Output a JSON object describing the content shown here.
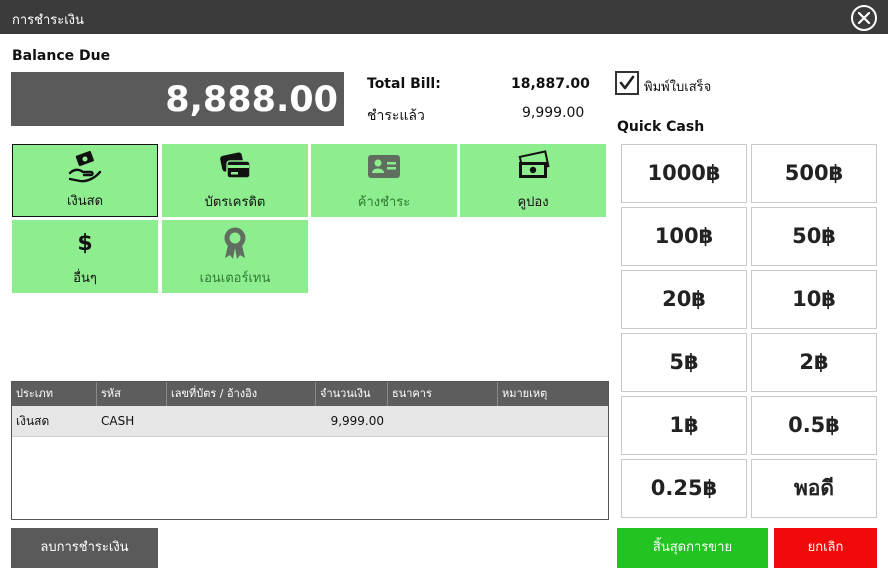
{
  "window": {
    "title": "การชำระเงิน"
  },
  "balance": {
    "label": "Balance Due",
    "amount": "8,888.00"
  },
  "bill": {
    "total_label": "Total Bill:",
    "total_value": "18,887.00",
    "paid_label": "ชำระแล้ว",
    "paid_value": "9,999.00"
  },
  "print_receipt": {
    "label": "พิมพ์ใบเสร็จ",
    "checked": true
  },
  "quick_cash": {
    "label": "Quick Cash",
    "buttons": [
      "1000฿",
      "500฿",
      "100฿",
      "50฿",
      "20฿",
      "10฿",
      "5฿",
      "2฿",
      "1฿",
      "0.5฿",
      "0.25฿",
      "พอดี"
    ]
  },
  "payment_methods": [
    {
      "label": "เงินสด",
      "icon": "cash-hand-icon",
      "selected": true
    },
    {
      "label": "บัตรเครดิต",
      "icon": "credit-card-icon"
    },
    {
      "label": "ค้างชำระ",
      "icon": "contact-card-icon"
    },
    {
      "label": "คูปอง",
      "icon": "money-bill-icon"
    },
    {
      "label": "อื่นๆ",
      "icon": "dollar-sign-icon"
    },
    {
      "label": "เอนเตอร์เทน",
      "icon": "award-icon"
    }
  ],
  "table": {
    "columns": [
      "ประเภท",
      "รหัส",
      "เลขที่บัตร / อ้างอิง",
      "จำนวนเงิน",
      "ธนาคาร",
      "หมายเหตุ"
    ],
    "rows": [
      {
        "type": "เงินสด",
        "code": "CASH",
        "ref": "",
        "amount": "9,999.00",
        "bank": "",
        "note": ""
      }
    ]
  },
  "actions": {
    "clear": "ลบการชำระเงิน",
    "finish": "สิ้นสุดการขาย",
    "cancel": "ยกเลิก"
  },
  "colors": {
    "titlebar": "#3b3b3b",
    "payment_button": "#8eed8e",
    "finish": "#21c421",
    "cancel": "#f00a0a",
    "dark_box": "#5a5a5a"
  }
}
